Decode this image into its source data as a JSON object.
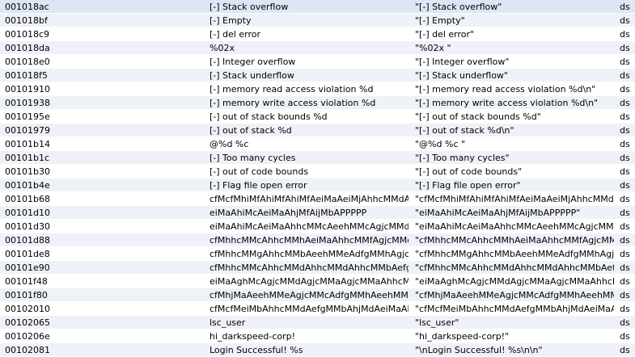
{
  "rows": [
    {
      "address": "001018ac",
      "string": "[-] Stack overflow",
      "literal": "\"[-] Stack overflow\"",
      "section": "ds"
    },
    {
      "address": "001018bf",
      "string": "[-] Empty",
      "literal": "\"[-] Empty\"",
      "section": "ds"
    },
    {
      "address": "001018c9",
      "string": "[-] del error",
      "literal": "\"[-] del error\"",
      "section": "ds"
    },
    {
      "address": "001018da",
      "string": "%02x",
      "literal": "\"%02x \"",
      "section": "ds"
    },
    {
      "address": "001018e0",
      "string": "[-] Integer overflow",
      "literal": "\"[-] Integer overflow\"",
      "section": "ds"
    },
    {
      "address": "001018f5",
      "string": "[-] Stack underflow",
      "literal": "\"[-] Stack underflow\"",
      "section": "ds"
    },
    {
      "address": "00101910",
      "string": "[-] memory read access violation %d",
      "literal": "\"[-] memory read access violation %d\\n\"",
      "section": "ds"
    },
    {
      "address": "00101938",
      "string": "[-] memory write access violation %d",
      "literal": "\"[-] memory write access violation %d\\n\"",
      "section": "ds"
    },
    {
      "address": "0010195e",
      "string": "[-] out of stack bounds %d",
      "literal": "\"[-] out of stack bounds %d\"",
      "section": "ds"
    },
    {
      "address": "00101979",
      "string": "[-] out of stack %d",
      "literal": "\"[-] out of stack %d\\n\"",
      "section": "ds"
    },
    {
      "address": "00101b14",
      "string": "@%d %c",
      "literal": "\"@%d %c \"",
      "section": "ds"
    },
    {
      "address": "00101b1c",
      "string": "[-] Too many cycles",
      "literal": "\"[-] Too many cycles\"",
      "section": "ds"
    },
    {
      "address": "00101b30",
      "string": "[-] out of code bounds",
      "literal": "\"[-] out of code bounds\"",
      "section": "ds"
    },
    {
      "address": "00101b4e",
      "string": "[-] Flag file open error",
      "literal": "\"[-] Flag file open error\"",
      "section": "ds"
    },
    {
      "address": "00101b68",
      "string": "cfMcfMhiMfAhiMfAhiMfAeiMaAeiMjAhhcMMdAgj...",
      "literal": "\"cfMcfMhiMfAhiMfAhiMfAeiMaAeiMjAhhcMMdAgj...",
      "section": "ds"
    },
    {
      "address": "00101d10",
      "string": "eiMaAhiMcAeiMaAhjMfAijMbAPPPPP",
      "literal": "\"eiMaAhiMcAeiMaAhjMfAijMbAPPPPP\"",
      "section": "ds"
    },
    {
      "address": "00101d30",
      "string": "eiMaAhiMcAeiMaAhhcMMcAeehMMcAgjcMMdAe...",
      "literal": "\"eiMaAhiMcAeiMaAhhcMMcAeehMMcAgjcMMdAe...",
      "section": "ds"
    },
    {
      "address": "00101d88",
      "string": "cfMhhcMMcAhhcMMhAeiMaAhhcMMfAgjcMMcAgj...",
      "literal": "\"cfMhhcMMcAhhcMMhAeiMaAhhcMMfAgjcMMcAg...",
      "section": "ds"
    },
    {
      "address": "00101de8",
      "string": "cfMhhcMMgAhhcMMbAeehMMeAdfgMMhAgjcMM...",
      "literal": "\"cfMhhcMMgAhhcMMbAeehMMeAdfgMMhAgjcMM...",
      "section": "ds"
    },
    {
      "address": "00101e90",
      "string": "cfMhhcMMcAhhcMMdAhhcMMdAhhcMMbAefgMM...",
      "literal": "\"cfMhhcMMcAhhcMMdAhhcMMdAhhcMMbAefgMM...",
      "section": "ds"
    },
    {
      "address": "00101f48",
      "string": "eiMaAghMcAgjcMMdAgjcMMaAgjcMMaAhhcMMd...",
      "literal": "\"eiMaAghMcAgjcMMdAgjcMMaAgjcMMaAhhcMMd...",
      "section": "ds"
    },
    {
      "address": "00101f80",
      "string": "cfMhjMaAeehMMeAgjcMMcAdfgMMhAeehMMhAe...",
      "literal": "\"cfMhjMaAeehMMeAgjcMMcAdfgMMhAeehMMhA...",
      "section": "ds"
    },
    {
      "address": "00102010",
      "string": "cfMcfMeiMbAhhcMMdAefgMMbAhjMdAeiMaAhhc...",
      "literal": "\"cfMcfMeiMbAhhcMMdAefgMMbAhjMdAeiMaAhh...",
      "section": "ds"
    },
    {
      "address": "00102065",
      "string": "lsc_user",
      "literal": "\"lsc_user\"",
      "section": "ds"
    },
    {
      "address": "0010206e",
      "string": "hi_darkspeed-corp!",
      "literal": "\"hi_darkspeed-corp!\"",
      "section": "ds"
    },
    {
      "address": "00102081",
      "string": "Login Successful! %s",
      "literal": "\"\\nLogin Successful! %s\\n\\n\"",
      "section": "ds"
    }
  ]
}
